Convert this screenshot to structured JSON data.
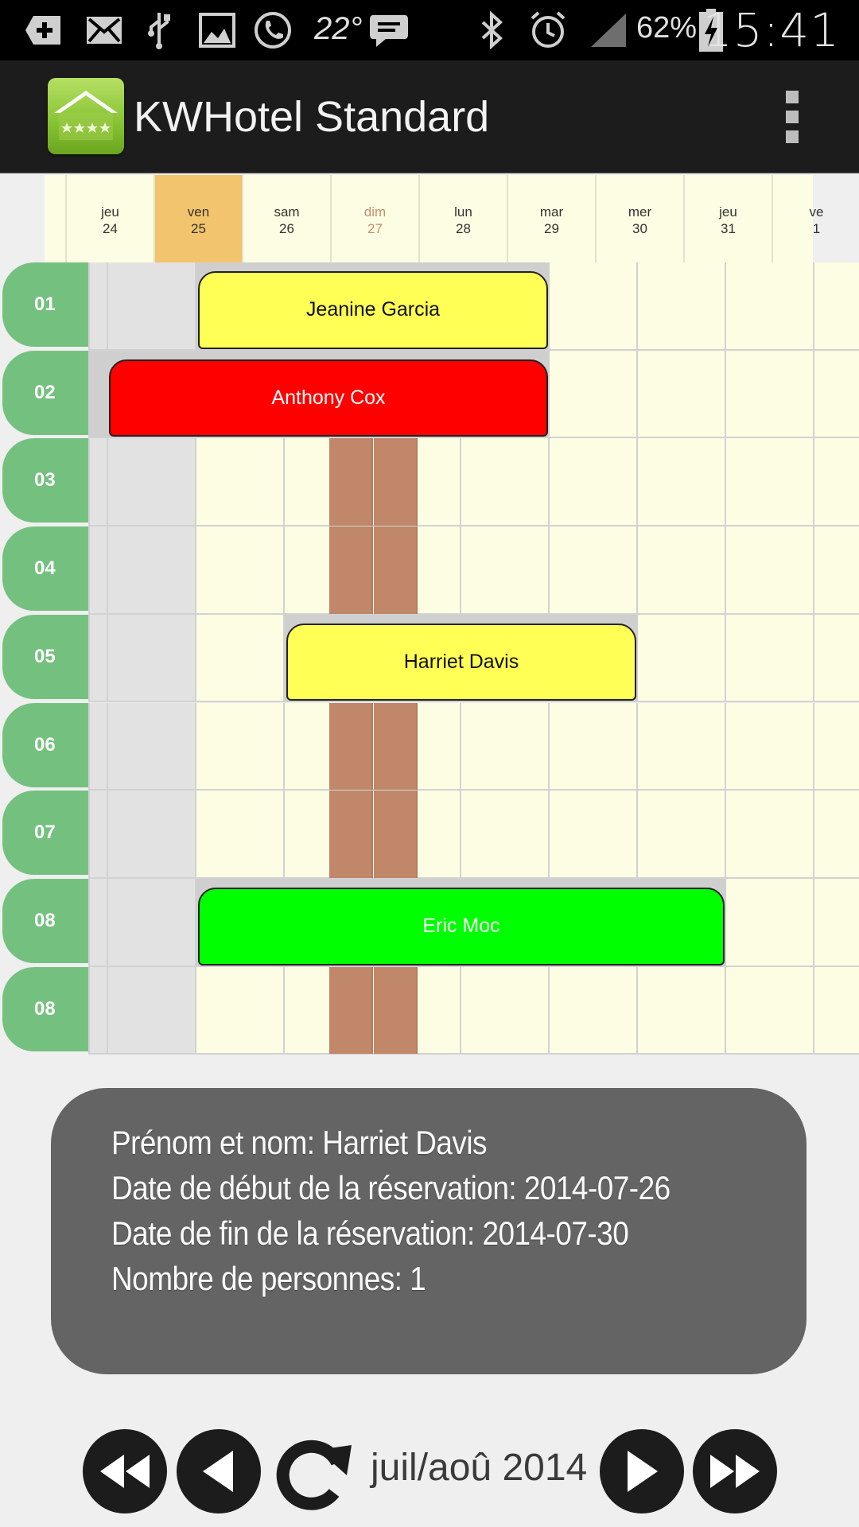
{
  "status_bar": {
    "time": "15:41",
    "battery_percent": "62%",
    "temperature": "22°",
    "icons": [
      "add-notification-icon",
      "mail-icon",
      "usb-icon",
      "image-icon",
      "phone-icon",
      "weather-temperature",
      "chat-icon",
      "bluetooth-icon",
      "alarm-icon",
      "signal-icon",
      "battery-charging-icon"
    ]
  },
  "app_bar": {
    "title": "KWHotel Standard",
    "logo_icon": "hotel-logo-icon",
    "menu_icon": "overflow-menu-icon"
  },
  "calendar": {
    "days": [
      {
        "weekday": "jeu",
        "day": "24",
        "selected": false,
        "sunday": false
      },
      {
        "weekday": "ven",
        "day": "25",
        "selected": true,
        "sunday": false
      },
      {
        "weekday": "sam",
        "day": "26",
        "selected": false,
        "sunday": false
      },
      {
        "weekday": "dim",
        "day": "27",
        "selected": false,
        "sunday": true
      },
      {
        "weekday": "lun",
        "day": "28",
        "selected": false,
        "sunday": false
      },
      {
        "weekday": "mar",
        "day": "29",
        "selected": false,
        "sunday": false
      },
      {
        "weekday": "mer",
        "day": "30",
        "selected": false,
        "sunday": false
      },
      {
        "weekday": "jeu",
        "day": "31",
        "selected": false,
        "sunday": false
      },
      {
        "weekday": "ve",
        "day": "1",
        "selected": false,
        "sunday": false
      }
    ],
    "rooms": [
      "01",
      "02",
      "03",
      "04",
      "05",
      "06",
      "07",
      "08",
      "08"
    ],
    "bookings": [
      {
        "room_index": 0,
        "guest": "Jeanine Garcia",
        "color": "#ffff55",
        "text_color": "#111111"
      },
      {
        "room_index": 1,
        "guest": "Anthony Cox",
        "color": "#ff0000",
        "text_color": "#ffffff"
      },
      {
        "room_index": 4,
        "guest": "Harriet Davis",
        "color": "#ffff55",
        "text_color": "#111111"
      },
      {
        "room_index": 7,
        "guest": "Eric Moc",
        "color": "#00ff00",
        "text_color": "#ffffff"
      }
    ]
  },
  "info_popup": {
    "name_line": "Prénom et nom: Harriet Davis",
    "start_line": "Date de début de la réservation: 2014-07-26",
    "end_line": "Date de fin de la réservation: 2014-07-30",
    "persons_line": "Nombre de personnes: 1"
  },
  "navigation": {
    "month_label": "juil/aoû 2014",
    "buttons": [
      "fast-rewind-icon",
      "previous-icon",
      "refresh-icon",
      "next-icon",
      "fast-forward-icon"
    ]
  },
  "colors": {
    "room_tab": "#74c17f",
    "selected_day": "#f2c46d",
    "sunday_band": "#c0876a",
    "cell_background": "#fdfde3"
  }
}
